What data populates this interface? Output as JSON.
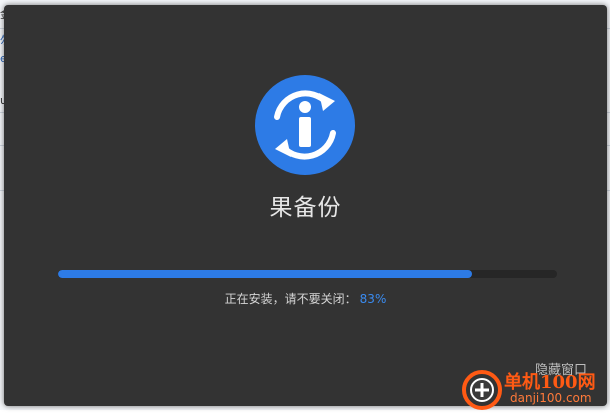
{
  "installer": {
    "app_name": "果备份",
    "logo_icon": "info-sync-icon",
    "progress_percent": 83,
    "status_text": "正在安装，请不要关闭：",
    "status_percent_text": "83%",
    "hide_window_label": "隐藏窗口",
    "colors": {
      "dialog_bg": "#333333",
      "accent_blue": "#2d7be6",
      "percent_blue": "#3a8bf0",
      "track": "#262626"
    }
  },
  "background": {
    "glyphs": [
      "金",
      "勿",
      "e",
      "u"
    ]
  },
  "watermark": {
    "brand": "单机100网",
    "domain": "danji100.com",
    "badge_icon": "plus-badge-icon",
    "color": "#ff5a14"
  }
}
